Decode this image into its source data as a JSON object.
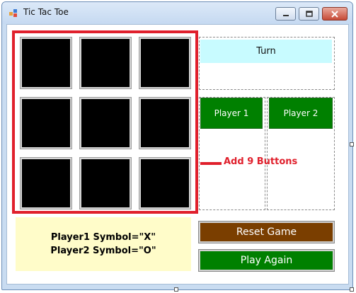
{
  "window": {
    "title": "Tic Tac Toe",
    "controls": [
      "minimize-icon",
      "maximize-icon",
      "close-icon"
    ]
  },
  "board": {
    "rows": 3,
    "cols": 3,
    "cell_color": "#000000",
    "highlight_color": "#e0202c"
  },
  "turn": {
    "label": "Turn",
    "bg_color": "#c8fbff"
  },
  "players": {
    "player1_label": "Player 1",
    "player2_label": "Player 2",
    "button_color": "#008000"
  },
  "annotation": {
    "text": "Add 9 Buttons",
    "color": "#e0202c"
  },
  "symbols": {
    "line1": "Player1 Symbol=\"X\"",
    "line2": "Player2 Symbol=\"O\"",
    "bg_color": "#fffcc9"
  },
  "actions": {
    "reset_label": "Reset Game",
    "reset_color": "#7a3e00",
    "play_again_label": "Play Again",
    "play_again_color": "#008000"
  }
}
